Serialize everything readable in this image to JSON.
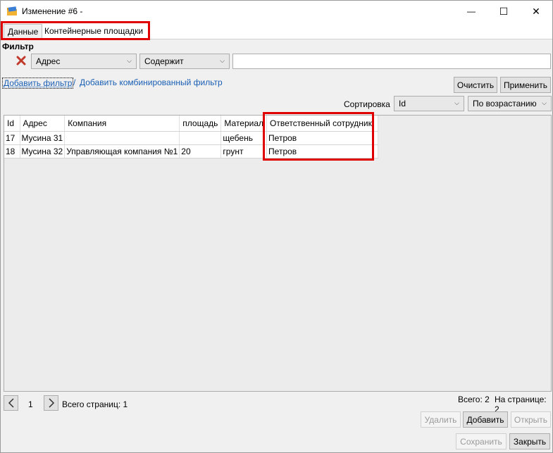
{
  "window": {
    "title": "Изменение #6 -",
    "minimize_label": "—",
    "maximize_label": "☐",
    "close_label": "✕"
  },
  "tabs": [
    {
      "label": "Данные",
      "active": true
    },
    {
      "label": "Контейнерные площадки",
      "active": false
    }
  ],
  "filter": {
    "title": "Фильтр",
    "field_value": "Адрес",
    "condition_value": "Содержит",
    "search_value": "",
    "add_filter_link": "Добавить фильтр",
    "separator": "/",
    "add_combined_link": "Добавить комбинированный фильтр",
    "clear_label": "Очистить",
    "apply_label": "Применить"
  },
  "sort": {
    "label": "Сортировка",
    "field_value": "Id",
    "direction_value": "По возрастанию"
  },
  "table": {
    "columns": [
      "Id",
      "Адрес",
      "Компания",
      "площадь",
      "Материал",
      "Ответственный сотрудник"
    ],
    "rows": [
      [
        "17",
        "Мусина 31",
        "",
        "",
        "щебень",
        "Петров"
      ],
      [
        "18",
        "Мусина 32",
        "Управляющая компания №1",
        "20",
        "грунт",
        "Петров"
      ]
    ]
  },
  "pager": {
    "current_page": "1",
    "total_pages_label": "Всего страниц: 1",
    "total_label": "Всего: 2",
    "per_page_label": "На странице: 2"
  },
  "actions": {
    "delete_label": "Удалить",
    "add_label": "Добавить",
    "open_label": "Открыть",
    "save_label": "Сохранить",
    "close_label": "Закрыть"
  },
  "colors": {
    "highlight": "#e00000",
    "link": "#1a5fb4",
    "delete_icon": "#c0392b"
  },
  "icons": {
    "app": "app-folder-icon",
    "remove_filter": "remove-filter-icon",
    "prev": "chevron-left-icon",
    "next": "chevron-right-icon"
  }
}
